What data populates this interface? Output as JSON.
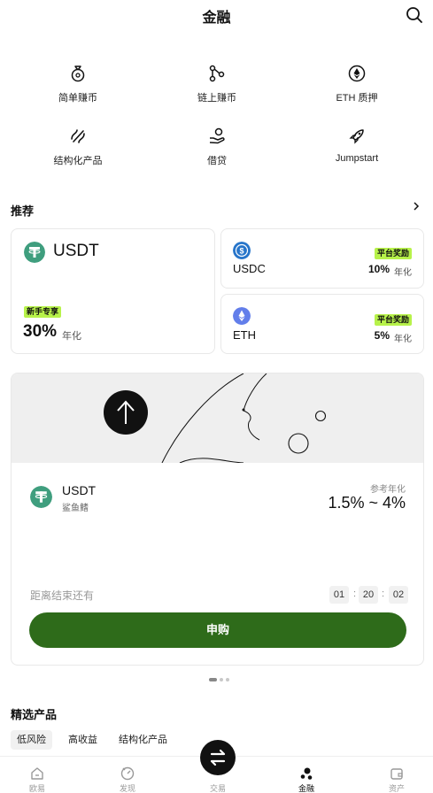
{
  "header": {
    "title": "金融"
  },
  "menu": [
    {
      "label": "简单赚币",
      "icon": "moneybag-icon"
    },
    {
      "label": "链上赚币",
      "icon": "chain-nodes-icon"
    },
    {
      "label": "ETH 质押",
      "icon": "eth-coin-icon"
    },
    {
      "label": "结构化产品",
      "icon": "structured-link-icon"
    },
    {
      "label": "借贷",
      "icon": "loan-hand-icon"
    },
    {
      "label": "Jumpstart",
      "icon": "rocket-icon"
    }
  ],
  "recommend": {
    "title": "推荐",
    "main": {
      "coin": "USDT",
      "badge": "新手专享",
      "rate": "30%",
      "rate_unit": "年化"
    },
    "side": [
      {
        "coin": "USDC",
        "badge": "平台奖励",
        "rate": "10%",
        "rate_unit": "年化"
      },
      {
        "coin": "ETH",
        "badge": "平台奖励",
        "rate": "5%",
        "rate_unit": "年化"
      }
    ]
  },
  "promo": {
    "coin": "USDT",
    "subtitle": "鲨鱼鳍",
    "rate_label": "参考年化",
    "rate": "1.5% ~ 4%",
    "countdown_label": "距离结束还有",
    "countdown": [
      "01",
      "20",
      "02"
    ],
    "cta": "申购"
  },
  "featured": {
    "title": "精选产品",
    "tabs": [
      "低风险",
      "高收益",
      "结构化产品"
    ]
  },
  "nav": [
    {
      "label": "欧易",
      "icon": "home-icon"
    },
    {
      "label": "发现",
      "icon": "discover-icon"
    },
    {
      "label": "交易",
      "icon": "trade-swap-icon"
    },
    {
      "label": "金融",
      "icon": "finance-dots-icon"
    },
    {
      "label": "资产",
      "icon": "wallet-icon"
    }
  ],
  "colors": {
    "accent_green": "#b7f24a",
    "button_green": "#2e6b1a",
    "usdt": "#3f9e7e",
    "usdc": "#2775ca",
    "eth": "#627eea"
  }
}
